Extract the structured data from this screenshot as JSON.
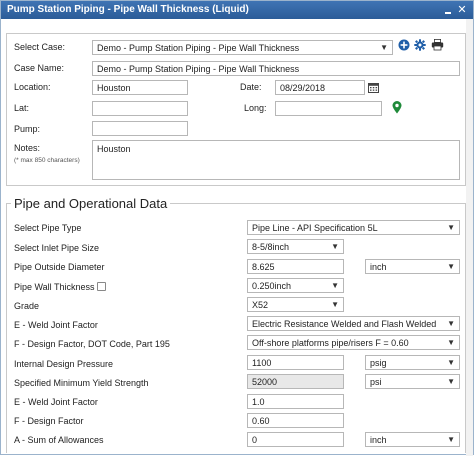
{
  "window": {
    "title": "Pump Station Piping - Pipe Wall Thickness (Liquid)"
  },
  "case": {
    "select_case_label": "Select Case:",
    "select_case_value": "Demo - Pump Station Piping - Pipe Wall Thickness",
    "case_name_label": "Case Name:",
    "case_name_value": "Demo - Pump Station Piping - Pipe Wall Thickness",
    "location_label": "Location:",
    "location_value": "Houston",
    "date_label": "Date:",
    "date_value": "08/29/2018",
    "lat_label": "Lat:",
    "lat_value": "",
    "long_label": "Long:",
    "long_value": "",
    "pump_label": "Pump:",
    "pump_value": "",
    "notes_label": "Notes:",
    "notes_hint": "(* max 850 characters)",
    "notes_value": "Houston"
  },
  "pipe": {
    "section_title": "Pipe and Operational Data",
    "pipe_type_label": "Select Pipe Type",
    "pipe_type_value": "Pipe Line - API Specification 5L",
    "inlet_size_label": "Select Inlet Pipe Size",
    "inlet_size_value": "8-5/8inch",
    "outside_diameter_label": "Pipe Outside Diameter",
    "outside_diameter_value": "8.625",
    "outside_diameter_unit": "inch",
    "wall_thickness_label": "Pipe Wall Thickness",
    "wall_thickness_value": "0.250inch",
    "grade_label": "Grade",
    "grade_value": "X52",
    "weld_factor_label": "E - Weld Joint Factor",
    "weld_factor_value": "Electric Resistance Welded and Flash Welded",
    "design_factor_label": "F - Design Factor, DOT Code, Part 195",
    "design_factor_value": "Off-shore platforms pipe/risers F = 0.60",
    "internal_pressure_label": "Internal Design Pressure",
    "internal_pressure_value": "1100",
    "internal_pressure_unit": "psig",
    "smys_label": "Specified Minimum Yield Strength",
    "smys_value": "52000",
    "smys_unit": "psi",
    "weld_factor2_label": "E - Weld Joint Factor",
    "weld_factor2_value": "1.0",
    "design_factor2_label": "F - Design Factor",
    "design_factor2_value": "0.60",
    "allowances_label": "A - Sum of Allowances",
    "allowances_value": "0",
    "allowances_unit": "inch"
  },
  "colors": {
    "titlebar": "#2f65a7",
    "map_marker": "#1f8a3a",
    "action_icon": "#1f5ea8"
  }
}
